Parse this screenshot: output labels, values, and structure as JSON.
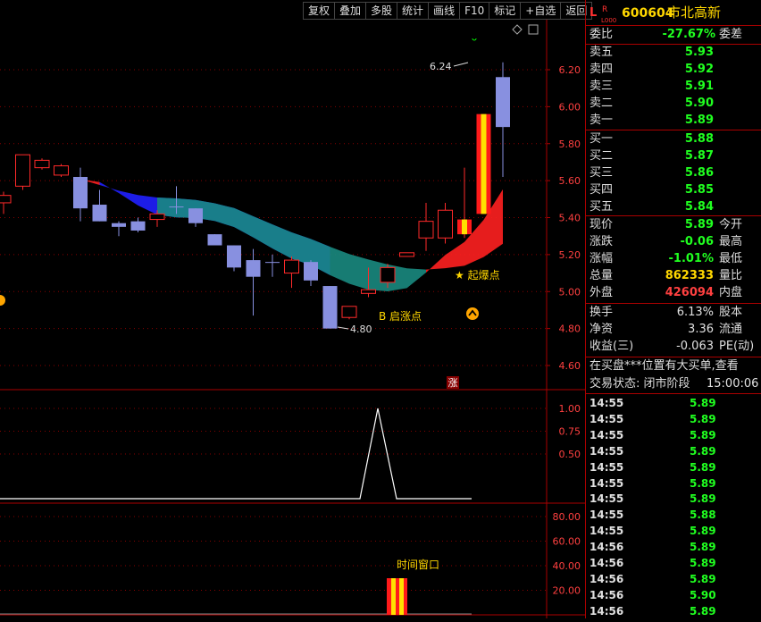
{
  "toolbar": [
    "复权",
    "叠加",
    "多股",
    "统计",
    "画线",
    "F10",
    "标记",
    "+自选",
    "返回"
  ],
  "header": {
    "badge_l": "L",
    "badge_r": "R",
    "badge_sub": "L000",
    "code": "600604",
    "name": "市北高新"
  },
  "weibi": {
    "label": "委比",
    "value": "-27.67%",
    "label2": "委差"
  },
  "sell": [
    {
      "label": "卖五",
      "price": "5.93"
    },
    {
      "label": "卖四",
      "price": "5.92"
    },
    {
      "label": "卖三",
      "price": "5.91"
    },
    {
      "label": "卖二",
      "price": "5.90"
    },
    {
      "label": "卖一",
      "price": "5.89"
    }
  ],
  "buy": [
    {
      "label": "买一",
      "price": "5.88"
    },
    {
      "label": "买二",
      "price": "5.87"
    },
    {
      "label": "买三",
      "price": "5.86"
    },
    {
      "label": "买四",
      "price": "5.85"
    },
    {
      "label": "买五",
      "price": "5.84"
    }
  ],
  "quote": [
    {
      "label": "现价",
      "value": "5.89",
      "label2": "今开",
      "color": "green"
    },
    {
      "label": "涨跌",
      "value": "-0.06",
      "label2": "最高",
      "color": "green"
    },
    {
      "label": "涨幅",
      "value": "-1.01%",
      "label2": "最低",
      "color": "green"
    },
    {
      "label": "总量",
      "value": "862333",
      "label2": "量比",
      "color": "yellow"
    },
    {
      "label": "外盘",
      "value": "426094",
      "label2": "内盘",
      "color": "red"
    }
  ],
  "extra": [
    {
      "label": "换手",
      "value": "6.13%",
      "label2": "股本"
    },
    {
      "label": "净资",
      "value": "3.36",
      "label2": "流通"
    },
    {
      "label": "收益(三)",
      "value": "-0.063",
      "label2": "PE(动)"
    }
  ],
  "notice": "在买盘***位置有大买单,查看",
  "trade_status": {
    "label": "交易状态: 闭市阶段",
    "time": "15:00:06"
  },
  "ticks": [
    {
      "time": "14:55",
      "price": "5.89"
    },
    {
      "time": "14:55",
      "price": "5.89"
    },
    {
      "time": "14:55",
      "price": "5.89"
    },
    {
      "time": "14:55",
      "price": "5.89"
    },
    {
      "time": "14:55",
      "price": "5.89"
    },
    {
      "time": "14:55",
      "price": "5.89"
    },
    {
      "time": "14:55",
      "price": "5.89"
    },
    {
      "time": "14:55",
      "price": "5.88"
    },
    {
      "time": "14:55",
      "price": "5.89"
    },
    {
      "time": "14:56",
      "price": "5.89"
    },
    {
      "time": "14:56",
      "price": "5.89"
    },
    {
      "time": "14:56",
      "price": "5.89"
    },
    {
      "time": "14:56",
      "price": "5.90"
    },
    {
      "time": "14:56",
      "price": "5.89"
    }
  ],
  "chart": {
    "price_ticks": [
      "6.20",
      "6.00",
      "5.80",
      "5.60",
      "5.40",
      "5.20",
      "5.00",
      "4.80",
      "4.60"
    ],
    "high_label": "6.24",
    "low_label": "4.80",
    "ann_start": "B 启涨点",
    "ann_burst": "★ 起爆点",
    "ann_zhang": "涨",
    "ann_window": "时间窗口",
    "sub1_ticks": [
      "1.00",
      "0.75",
      "0.50"
    ],
    "sub2_ticks": [
      "80.00",
      "60.00",
      "40.00",
      "20.00"
    ],
    "candles": [
      {
        "o": 5.48,
        "h": 5.54,
        "l": 5.42,
        "c": 5.52,
        "up": true
      },
      {
        "o": 5.57,
        "h": 5.74,
        "l": 5.55,
        "c": 5.74,
        "up": true
      },
      {
        "o": 5.67,
        "h": 5.72,
        "l": 5.66,
        "c": 5.71,
        "up": true
      },
      {
        "o": 5.63,
        "h": 5.69,
        "l": 5.62,
        "c": 5.68,
        "up": true
      },
      {
        "o": 5.62,
        "h": 5.67,
        "l": 5.38,
        "c": 5.45,
        "up": false
      },
      {
        "o": 5.47,
        "h": 5.55,
        "l": 5.38,
        "c": 5.38,
        "up": false
      },
      {
        "o": 5.37,
        "h": 5.38,
        "l": 5.3,
        "c": 5.35,
        "up": false
      },
      {
        "o": 5.38,
        "h": 5.4,
        "l": 5.32,
        "c": 5.33,
        "up": false
      },
      {
        "o": 5.39,
        "h": 5.44,
        "l": 5.35,
        "c": 5.42,
        "up": true
      },
      {
        "o": 5.46,
        "h": 5.57,
        "l": 5.42,
        "c": 5.46,
        "up": false
      },
      {
        "o": 5.45,
        "h": 5.45,
        "l": 5.35,
        "c": 5.37,
        "up": false
      },
      {
        "o": 5.31,
        "h": 5.31,
        "l": 5.25,
        "c": 5.25,
        "up": false
      },
      {
        "o": 5.25,
        "h": 5.25,
        "l": 5.11,
        "c": 5.13,
        "up": false
      },
      {
        "o": 5.17,
        "h": 5.23,
        "l": 4.87,
        "c": 5.08,
        "up": false
      },
      {
        "o": 5.16,
        "h": 5.2,
        "l": 5.08,
        "c": 5.16,
        "up": false
      },
      {
        "o": 5.1,
        "h": 5.19,
        "l": 5.02,
        "c": 5.17,
        "up": true
      },
      {
        "o": 5.16,
        "h": 5.17,
        "l": 5.03,
        "c": 5.06,
        "up": false
      },
      {
        "o": 5.03,
        "h": 5.03,
        "l": 4.8,
        "c": 4.8,
        "up": false
      },
      {
        "o": 4.86,
        "h": 4.92,
        "l": 4.85,
        "c": 4.92,
        "up": true
      },
      {
        "o": 4.99,
        "h": 5.13,
        "l": 4.97,
        "c": 5.01,
        "up": true
      },
      {
        "o": 5.05,
        "h": 5.15,
        "l": 5.02,
        "c": 5.13,
        "up": true
      },
      {
        "o": 5.19,
        "h": 5.21,
        "l": 5.19,
        "c": 5.21,
        "up": true
      },
      {
        "o": 5.29,
        "h": 5.48,
        "l": 5.22,
        "c": 5.38,
        "up": true
      },
      {
        "o": 5.29,
        "h": 5.48,
        "l": 5.26,
        "c": 5.44,
        "up": true
      },
      {
        "o": 5.31,
        "h": 5.67,
        "l": 5.29,
        "c": 5.39,
        "up": true
      },
      {
        "o": 5.42,
        "h": 5.96,
        "l": 5.42,
        "c": 5.96,
        "up": true
      },
      {
        "o": 6.16,
        "h": 6.24,
        "l": 5.62,
        "c": 5.89,
        "up": false
      }
    ]
  }
}
